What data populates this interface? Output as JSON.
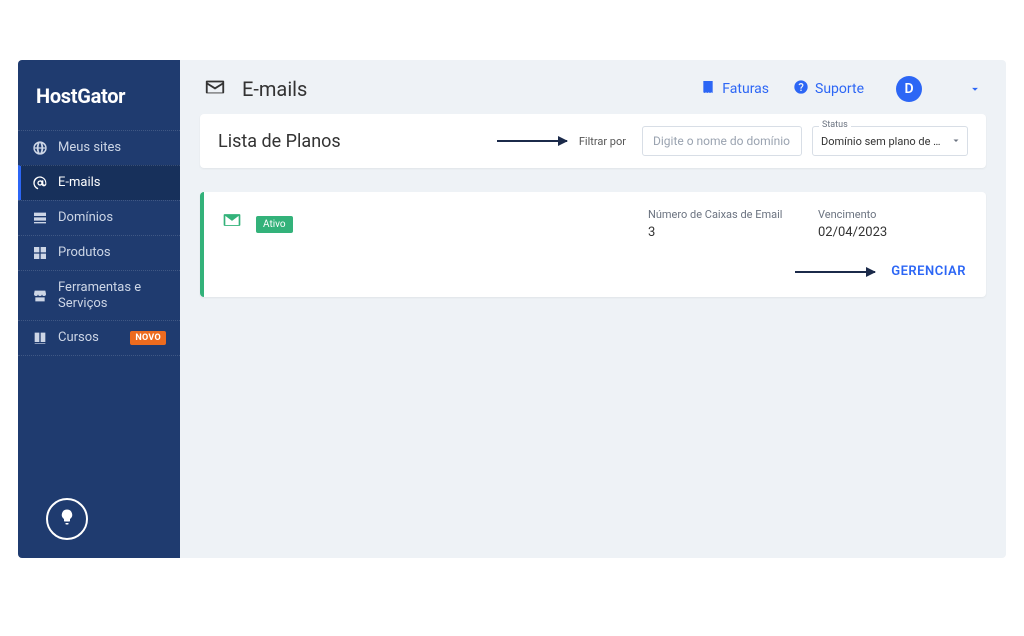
{
  "brand": "HostGator",
  "sidebar": {
    "items": [
      {
        "label": "Meus sites",
        "icon": "globe"
      },
      {
        "label": "E-mails",
        "icon": "at"
      },
      {
        "label": "Domínios",
        "icon": "server"
      },
      {
        "label": "Produtos",
        "icon": "grid"
      },
      {
        "label": "Ferramentas e Serviços",
        "icon": "store"
      },
      {
        "label": "Cursos",
        "icon": "book",
        "badge": "NOVO"
      }
    ]
  },
  "header": {
    "title": "E-mails",
    "invoices": "Faturas",
    "support": "Suporte",
    "avatar_initial": "D"
  },
  "filter_panel": {
    "title": "Lista de Planos",
    "filter_label": "Filtrar por",
    "placeholder": "Digite o nome do domínio",
    "status_legend": "Status",
    "status_value": "Domínio sem plano de …"
  },
  "plan_card": {
    "status_tag": "Ativo",
    "boxes_label": "Número de Caixas de Email",
    "boxes_value": "3",
    "exp_label": "Vencimento",
    "exp_value": "02/04/2023",
    "manage": "GERENCIAR"
  }
}
